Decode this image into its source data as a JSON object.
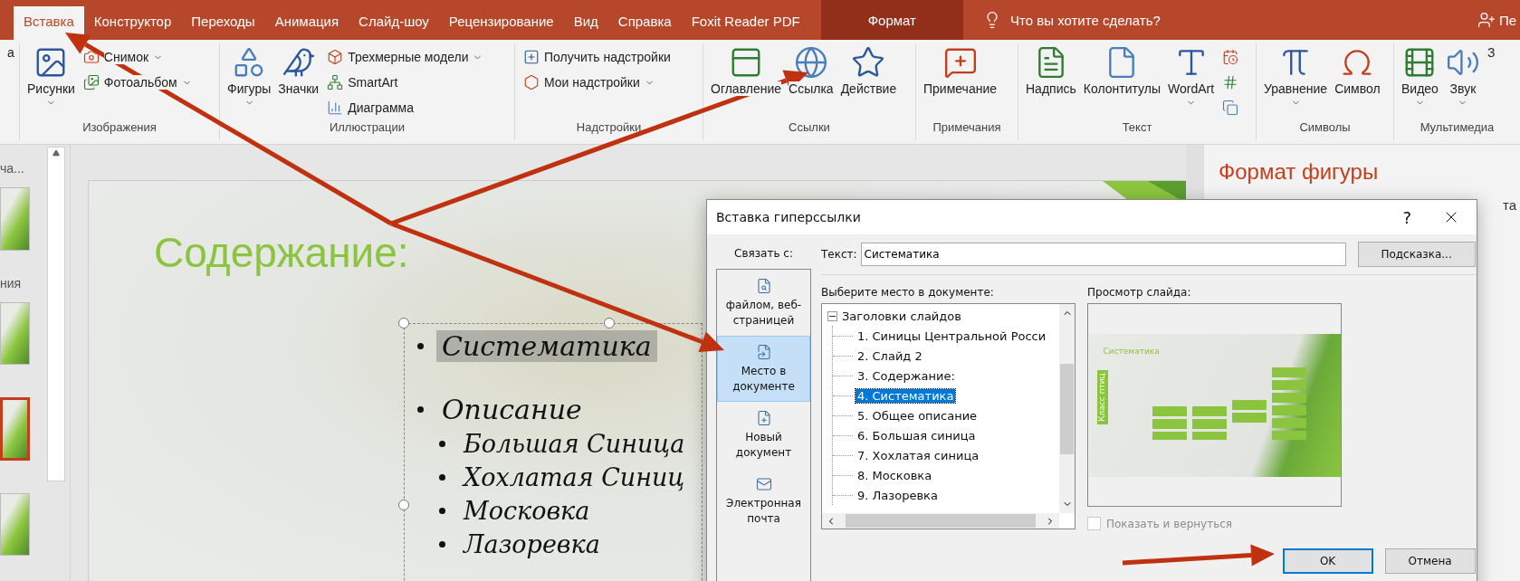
{
  "tabs": [
    {
      "label": "Вставка",
      "selected": true,
      "kind": "normal"
    },
    {
      "label": "Конструктор",
      "selected": false,
      "kind": "normal"
    },
    {
      "label": "Переходы",
      "selected": false,
      "kind": "normal"
    },
    {
      "label": "Анимация",
      "selected": false,
      "kind": "normal"
    },
    {
      "label": "Слайд-шоу",
      "selected": false,
      "kind": "normal"
    },
    {
      "label": "Рецензирование",
      "selected": false,
      "kind": "normal"
    },
    {
      "label": "Вид",
      "selected": false,
      "kind": "normal"
    },
    {
      "label": "Справка",
      "selected": false,
      "kind": "normal"
    },
    {
      "label": "Foxit Reader PDF",
      "selected": false,
      "kind": "normal"
    },
    {
      "label": "Формат",
      "selected": false,
      "kind": "contextual"
    }
  ],
  "tell_me": {
    "text": "Что вы хотите сделать?"
  },
  "user": {
    "label": "Пе"
  },
  "ribbon": {
    "groups": [
      {
        "items": [
          {
            "label": "а",
            "kind": "large",
            "dropdown": false
          }
        ]
      },
      {
        "label": "Изображения",
        "items": [
          {
            "label": "Рисунки",
            "kind": "large",
            "dropdown": true
          },
          {
            "label": "Снимок",
            "kind": "small",
            "dropdown": true
          },
          {
            "label": "Фотоальбом",
            "kind": "small",
            "dropdown": true
          }
        ]
      },
      {
        "label": "Иллюстрации",
        "items": [
          {
            "label": "Фигуры",
            "kind": "large",
            "dropdown": true
          },
          {
            "label": "Значки",
            "kind": "large",
            "dropdown": false
          },
          {
            "label": "Трехмерные модели",
            "kind": "small",
            "dropdown": true
          },
          {
            "label": "SmartArt",
            "kind": "small",
            "dropdown": false
          },
          {
            "label": "Диаграмма",
            "kind": "small",
            "dropdown": false
          }
        ]
      },
      {
        "label": "Надстройки",
        "items": [
          {
            "label": "Получить надстройки",
            "kind": "small",
            "dropdown": false
          },
          {
            "label": "Мои надстройки",
            "kind": "small",
            "dropdown": true
          }
        ]
      },
      {
        "label": "Ссылки",
        "items": [
          {
            "label": "Оглавление",
            "kind": "large",
            "dropdown": false
          },
          {
            "label": "Ссылка",
            "kind": "large",
            "dropdown": false
          },
          {
            "label": "Действие",
            "kind": "large",
            "dropdown": false
          }
        ]
      },
      {
        "label": "Примечания",
        "items": [
          {
            "label": "Примечание",
            "kind": "large",
            "dropdown": false
          }
        ]
      },
      {
        "label": "Текст",
        "items": [
          {
            "label": "Надпись",
            "kind": "large",
            "dropdown": false
          },
          {
            "label": "Колонтитулы",
            "kind": "large",
            "dropdown": false
          },
          {
            "label": "WordArt",
            "kind": "large",
            "dropdown": true
          },
          {
            "kind": "icon",
            "dropdown": false
          },
          {
            "kind": "icon",
            "dropdown": false
          },
          {
            "kind": "icon",
            "dropdown": false
          }
        ]
      },
      {
        "label": "Символы",
        "items": [
          {
            "label": "Уравнение",
            "kind": "large",
            "dropdown": true
          },
          {
            "label": "Символ",
            "kind": "large",
            "dropdown": false
          }
        ]
      },
      {
        "label": "Мультимедиа",
        "items": [
          {
            "label": "Видео",
            "kind": "large",
            "dropdown": true
          },
          {
            "label": "Звук",
            "kind": "large",
            "dropdown": true
          },
          {
            "label": "З",
            "kind": "large",
            "dropdown": false
          }
        ]
      }
    ]
  },
  "slides_pane": {
    "items": [
      {
        "kind": "section",
        "label": "ча..."
      },
      {
        "kind": "thumb",
        "selected": false
      },
      {
        "kind": "section",
        "label": "ния"
      },
      {
        "kind": "thumb",
        "selected": false
      },
      {
        "kind": "thumb",
        "selected": true
      },
      {
        "kind": "thumb",
        "selected": false
      }
    ]
  },
  "slide": {
    "title": "Содержание:",
    "bullets": [
      {
        "text": "Систематика",
        "highlighted": true
      },
      {
        "text": "Описание",
        "highlighted": false,
        "children": [
          {
            "text": "Большая Синица",
            "highlighted": false
          },
          {
            "text": "Хохлатая Синиц",
            "highlighted": false
          },
          {
            "text": "Московка",
            "highlighted": false
          },
          {
            "text": "Лазоревка",
            "highlighted": false
          }
        ]
      }
    ]
  },
  "format_pane": {
    "title": "Формат фигуры",
    "text": "та"
  },
  "dialog": {
    "title": "Вставка гиперссылки",
    "help": "?",
    "link_label": "Связать с:",
    "link_targets": [
      {
        "label": "файлом, веб-страницей",
        "selected": false
      },
      {
        "label": "Место в документе",
        "selected": true
      },
      {
        "label": "Новый документ",
        "selected": false
      },
      {
        "label": "Электронная почта",
        "selected": false
      }
    ],
    "text_label": "Текст:",
    "text_value": "Систематика",
    "tip_button": "Подсказка...",
    "place_label": "Выберите место в документе:",
    "tree": [
      {
        "label": "Заголовки слайдов",
        "expanded": true,
        "selected": false,
        "children": [
          {
            "label": "1. Синицы Центральной Росси",
            "selected": false
          },
          {
            "label": "2. Слайд 2",
            "selected": false
          },
          {
            "label": "3. Содержание:",
            "selected": false
          },
          {
            "label": "4. Систематика",
            "selected": true
          },
          {
            "label": "5. Общее описание",
            "selected": false
          },
          {
            "label": "6. Большая синица",
            "selected": false
          },
          {
            "label": "7. Хохлатая синица",
            "selected": false
          },
          {
            "label": "8. Московка",
            "selected": false
          },
          {
            "label": "9. Лазоревка",
            "selected": false
          }
        ]
      }
    ],
    "preview_label": "Просмотр слайда:",
    "preview": {
      "title": "Систематика",
      "vertical_label": "Класс птиц"
    },
    "show_and_return": {
      "label": "Показать и вернуться",
      "checked": false,
      "disabled": true
    },
    "buttons": [
      {
        "label": "OK",
        "default": true
      },
      {
        "label": "Отмена",
        "default": false
      }
    ]
  }
}
